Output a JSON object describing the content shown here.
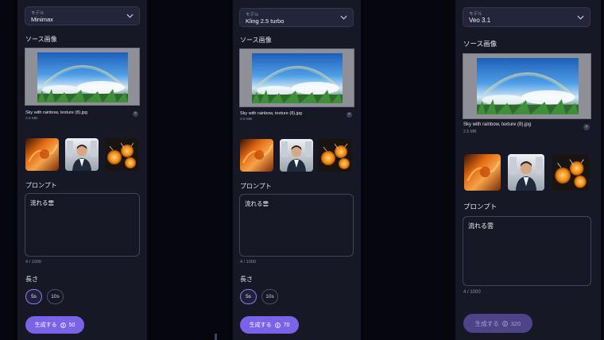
{
  "panels": [
    {
      "model_caption": "モデル",
      "model_value": "Minimax",
      "source_label": "ソース画像",
      "file_name": "Sky with rainbow, texture (8).jpg",
      "file_size": "2.6 MB",
      "remove_icon": "×",
      "prompt_label": "プロンプト",
      "prompt_value": "流れる雲",
      "char_count": "4 / 1000",
      "duration_label": "長さ",
      "durations": [
        "5s",
        "10s"
      ],
      "generate_label": "生成する",
      "cost": "50"
    },
    {
      "model_caption": "モデル",
      "model_value": "Kling 2.5 turbo",
      "source_label": "ソース画像",
      "file_name": "Sky with rainbow, texture (8).jpg",
      "file_size": "2.5 MB",
      "remove_icon": "×",
      "prompt_label": "プロンプト",
      "prompt_value": "流れる雲",
      "char_count": "4 / 1000",
      "duration_label": "長さ",
      "durations": [
        "5s",
        "10s"
      ],
      "generate_label": "生成する",
      "cost": "70"
    },
    {
      "model_caption": "モデル",
      "model_value": "Veo 3.1",
      "source_label": "ソース画像",
      "file_name": "Sky with rainbow, texture (8).jpg",
      "file_size": "2.5 MB",
      "remove_icon": "×",
      "prompt_label": "プロンプト",
      "prompt_value": "流れる雲",
      "char_count": "4 / 1000",
      "generate_label": "生成する",
      "cost": "320"
    }
  ],
  "icons": {
    "dropdown": "chevron-down-icon",
    "remove": "close-icon",
    "credits": "coin-icon"
  },
  "colors": {
    "accent": "#7a63e8",
    "accent_disabled": "#4e4288",
    "panel_bg": "#161826",
    "page_bg": "#06070e"
  }
}
